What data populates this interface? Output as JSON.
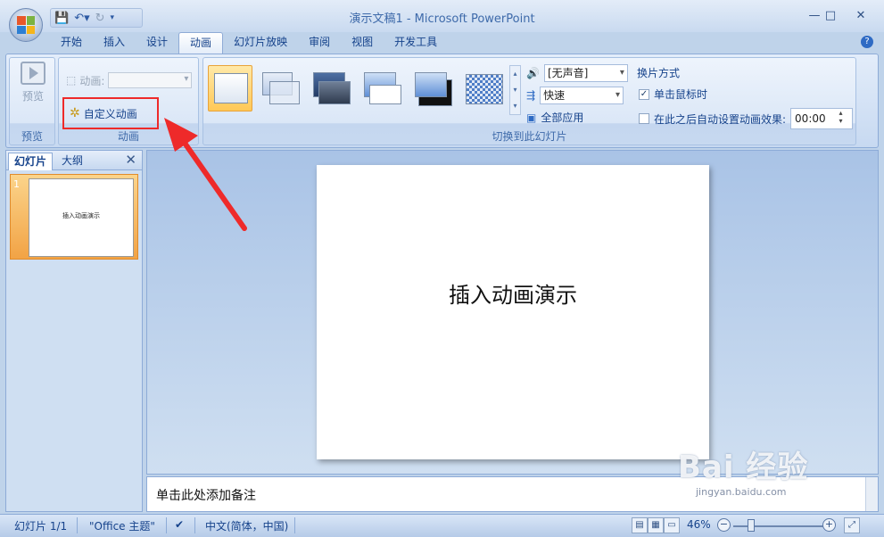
{
  "window": {
    "title": "演示文稿1 - Microsoft PowerPoint",
    "minimize": "—",
    "maximize": "□",
    "close": "✕"
  },
  "ribbon_tabs": [
    "开始",
    "插入",
    "设计",
    "动画",
    "幻灯片放映",
    "审阅",
    "视图",
    "开发工具"
  ],
  "active_tab": "动画",
  "ribbon": {
    "preview_group": {
      "button_label": "预览",
      "group_label": "预览"
    },
    "animation_group": {
      "animation_label": "动画:",
      "custom_animation_label": "自定义动画",
      "group_label": "动画"
    },
    "transition_group": {
      "group_label": "切换到此幻灯片",
      "sound_value": "[无声音]",
      "speed_value": "快速",
      "apply_all_label": "全部应用",
      "advance_title": "换片方式",
      "on_click_label": "单击鼠标时",
      "on_click_checked": true,
      "auto_after_label": "在此之后自动设置动画效果:",
      "auto_after_checked": false,
      "auto_after_time": "00:00"
    }
  },
  "left_pane": {
    "tabs": [
      "幻灯片",
      "大纲"
    ],
    "active_tab": "幻灯片",
    "thumbnails": [
      {
        "number": "1",
        "text": "插入动画演示"
      }
    ]
  },
  "slide": {
    "title": "插入动画演示"
  },
  "notes": {
    "placeholder": "单击此处添加备注"
  },
  "status_bar": {
    "slide_position": "幻灯片 1/1",
    "theme": "\"Office 主题\"",
    "language": "中文(简体，中国)",
    "zoom": "46%",
    "zoom_level": 0.46
  },
  "watermark": {
    "text": "Bai 经验",
    "subtext": "jingyan.baidu.com"
  },
  "colors": {
    "accent_red": "#ee2a2a",
    "ribbon_blue": "#c7d9f1",
    "selected_orange": "#f2a345"
  },
  "icons": {
    "save": "save-icon",
    "undo": "undo-icon",
    "redo": "redo-icon",
    "help": "help-icon",
    "sound": "sound-icon",
    "speed": "speed-icon",
    "apply_all": "apply-all-icon",
    "custom_animation": "custom-animation-icon"
  }
}
